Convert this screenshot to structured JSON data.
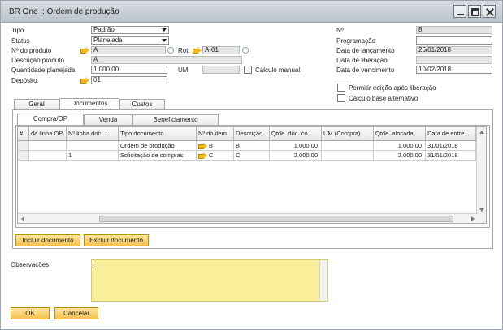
{
  "window": {
    "title": "BR One :: Ordem de produção"
  },
  "header": {
    "tipo_label": "Tipo",
    "tipo_value": "Padrão",
    "status_label": "Status",
    "status_value": "Planejada",
    "numero_produto_label": "Nº do produto",
    "numero_produto_value": "A",
    "rot_label": "Rot.",
    "rot_value": "A-01",
    "descricao_produto_label": "Descrição produto",
    "descricao_produto_value": "A",
    "quantidade_planejada_label": "Quantidade planejada",
    "quantidade_planejada_value": "1.000,00",
    "um_label": "UM",
    "um_value": "",
    "calculo_manual_label": "Cálculo manual",
    "deposito_label": "Depósito",
    "deposito_value": "01",
    "numero_label": "Nº",
    "numero_value": "8",
    "programacao_label": "Programação",
    "programacao_value": "",
    "data_lancamento_label": "Data de lançamento",
    "data_lancamento_value": "26/01/2018",
    "data_liberacao_label": "Data de liberação",
    "data_liberacao_value": "",
    "data_vencimento_label": "Data de vencimento",
    "data_vencimento_value": "10/02/2018",
    "permitir_edicao_label": "Permitir edição após liberação",
    "calculo_base_label": "Cálculo base alternativo"
  },
  "tabs": {
    "main": [
      "Geral",
      "Documentos",
      "Custos"
    ],
    "sub": [
      "Compra/OP",
      "Venda",
      "Beneficiamento"
    ]
  },
  "grid": {
    "columns": [
      "#",
      "da linha OP",
      "Nº linha doc. ...",
      "Tipo documento",
      "Nº do item",
      "Descrição",
      "Qtde. doc. co...",
      "UM (Compra)",
      "Qtde. alocada",
      "Data de entre..."
    ],
    "rows": [
      [
        "",
        "",
        "",
        "Ordem de produção",
        "B",
        "B",
        "1.000,00",
        "",
        "1.000,00",
        "31/01/2018"
      ],
      [
        "",
        "",
        "1",
        "Solicitação de compras",
        "C",
        "C",
        "2.000,00",
        "",
        "2.000,00",
        "31/01/2018"
      ]
    ]
  },
  "buttons": {
    "incluir_documento": "Incluir documento",
    "excluir_documento": "Excluir documento",
    "ok": "OK",
    "cancelar": "Cancelar"
  },
  "observacoes": {
    "label": "Observações",
    "value": ""
  },
  "icons": {
    "link_arrow": "link-arrow-icon",
    "lookup": "lookup-icon",
    "dropdown": "dropdown-arrow-icon"
  },
  "colors": {
    "button_fill": "#f7c14f",
    "observations_fill": "#f9ef9a",
    "title_bar": "#c8ced5"
  }
}
